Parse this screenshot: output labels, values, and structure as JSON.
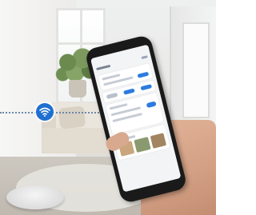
{
  "scene": {
    "colors": {
      "wifi_badge": "#1e6fd0",
      "app_accent": "#2d7be0",
      "dotted_line": "#6e86a8"
    },
    "icons": {
      "wifi_badge": "wifi-icon"
    },
    "phone_app": {
      "cards": 4
    }
  }
}
